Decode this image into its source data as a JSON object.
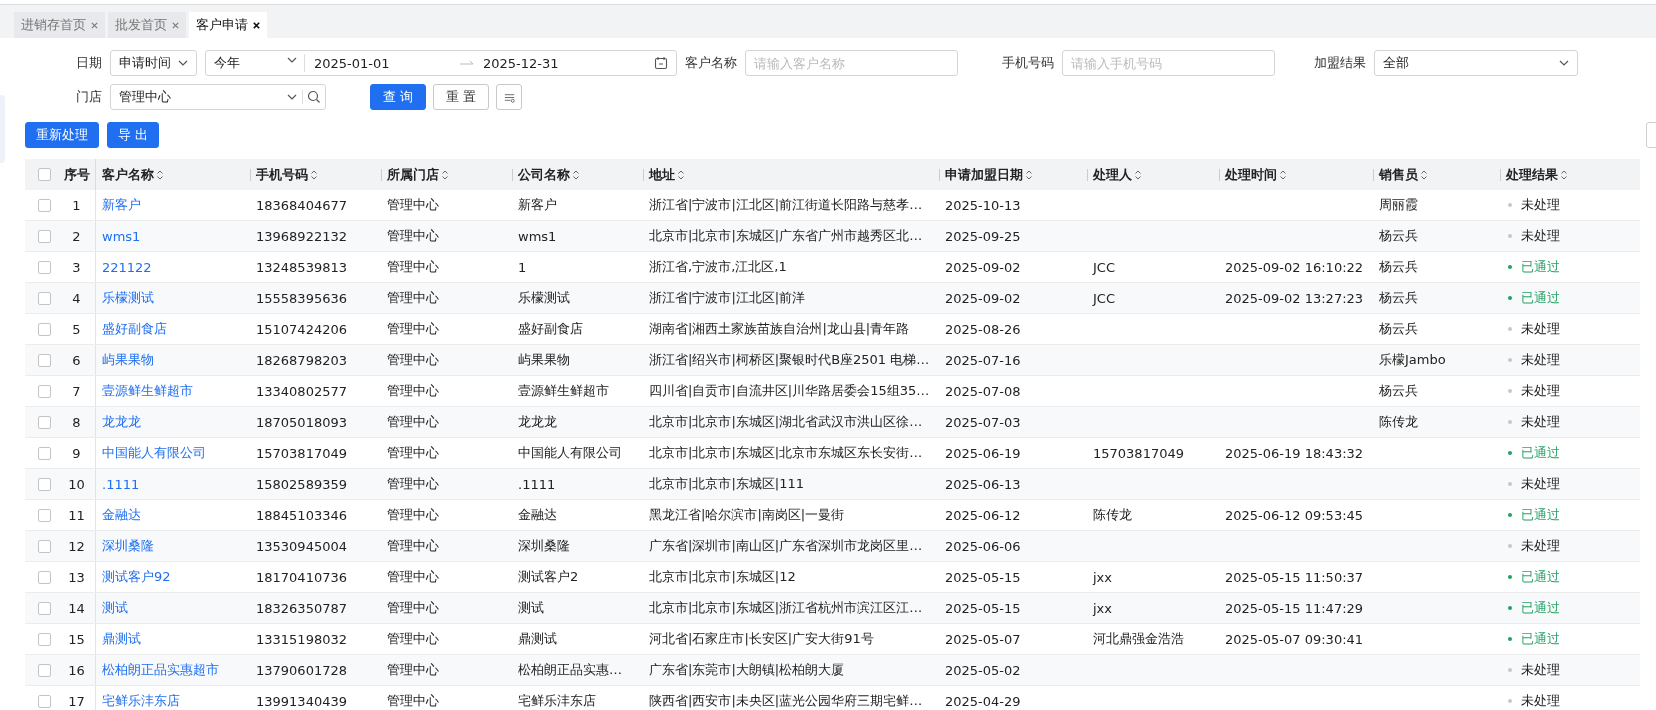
{
  "tabs": [
    {
      "label": "进销存首页",
      "selected": false
    },
    {
      "label": "批发首页",
      "selected": false
    },
    {
      "label": "客户申请",
      "selected": true
    }
  ],
  "filters": {
    "date_label": "日期",
    "date_type": "申请时间",
    "range_preset": "今年",
    "start_date": "2025-01-01",
    "end_date": "2025-12-31",
    "customer_label": "客户名称",
    "customer_placeholder": "请输入客户名称",
    "phone_label": "手机号码",
    "phone_placeholder": "请输入手机号码",
    "result_label": "加盟结果",
    "result_value": "全部",
    "store_label": "门店",
    "store_value": "管理中心",
    "query_button": "查 询",
    "reset_button": "重 置"
  },
  "actions": [
    "重新处理",
    "导 出"
  ],
  "table": {
    "select_all": {
      "checked": false
    },
    "columns": [
      "序号",
      "客户名称",
      "手机号码",
      "所属门店",
      "公司名称",
      "地址",
      "申请加盟日期",
      "处理人",
      "处理时间",
      "销售员",
      "处理结果"
    ],
    "rows": [
      {
        "checked": false,
        "index": "1",
        "name": "新客户",
        "phone": "18368404677",
        "store": "管理中心",
        "company": "新客户",
        "address": "浙江省|宁波市|江北区|前江街道长阳路与慈孝…",
        "date": "2025-10-13",
        "handler": "",
        "time": "",
        "sales": "周丽霞",
        "result": "未处理",
        "kind": "pending"
      },
      {
        "checked": false,
        "index": "2",
        "name": "wms1",
        "phone": "13968922132",
        "store": "管理中心",
        "company": "wms1",
        "address": "北京市|北京市|东城区|广东省广州市越秀区北…",
        "date": "2025-09-25",
        "handler": "",
        "time": "",
        "sales": "杨云兵",
        "result": "未处理",
        "kind": "pending"
      },
      {
        "checked": false,
        "index": "3",
        "name": "221122",
        "phone": "13248539813",
        "store": "管理中心",
        "company": "1",
        "address": "浙江省,宁波市,江北区,1",
        "date": "2025-09-02",
        "handler": "JCC",
        "time": "2025-09-02 16:10:22",
        "sales": "杨云兵",
        "result": "已通过",
        "kind": "approved"
      },
      {
        "checked": false,
        "index": "4",
        "name": "乐檬测试",
        "phone": "15558395636",
        "store": "管理中心",
        "company": "乐檬测试",
        "address": "浙江省|宁波市|江北区|前洋",
        "date": "2025-09-02",
        "handler": "JCC",
        "time": "2025-09-02 13:27:23",
        "sales": "杨云兵",
        "result": "已通过",
        "kind": "approved"
      },
      {
        "checked": false,
        "index": "5",
        "name": "盛好副食店",
        "phone": "15107424206",
        "store": "管理中心",
        "company": "盛好副食店",
        "address": "湖南省|湘西土家族苗族自治州|龙山县|青年路",
        "date": "2025-08-26",
        "handler": "",
        "time": "",
        "sales": "杨云兵",
        "result": "未处理",
        "kind": "pending"
      },
      {
        "checked": false,
        "index": "6",
        "name": "屿果果物",
        "phone": "18268798203",
        "store": "管理中心",
        "company": "屿果果物",
        "address": "浙江省|绍兴市|柯桥区|聚银时代B座2501 电梯…",
        "date": "2025-07-16",
        "handler": "",
        "time": "",
        "sales": "乐檬Jambo",
        "result": "未处理",
        "kind": "pending"
      },
      {
        "checked": false,
        "index": "7",
        "name": "壹源鲜生鲜超市",
        "phone": "13340802577",
        "store": "管理中心",
        "company": "壹源鲜生鲜超市",
        "address": "四川省|自贡市|自流井区|川华路居委会15组35…",
        "date": "2025-07-08",
        "handler": "",
        "time": "",
        "sales": "杨云兵",
        "result": "未处理",
        "kind": "pending"
      },
      {
        "checked": false,
        "index": "8",
        "name": "龙龙龙",
        "phone": "18705018093",
        "store": "管理中心",
        "company": "龙龙龙",
        "address": "北京市|北京市|东城区|湖北省武汉市洪山区徐…",
        "date": "2025-07-03",
        "handler": "",
        "time": "",
        "sales": "陈传龙",
        "result": "未处理",
        "kind": "pending"
      },
      {
        "checked": false,
        "index": "9",
        "name": "中国能人有限公司",
        "phone": "15703817049",
        "store": "管理中心",
        "company": "中国能人有限公司",
        "address": "北京市|北京市|东城区|北京市东城区东长安街…",
        "date": "2025-06-19",
        "handler": "15703817049",
        "time": "2025-06-19 18:43:32",
        "sales": "",
        "result": "已通过",
        "kind": "approved"
      },
      {
        "checked": false,
        "index": "10",
        "name": ".1111",
        "phone": "15802589359",
        "store": "管理中心",
        "company": ".1111",
        "address": "北京市|北京市|东城区|111",
        "date": "2025-06-13",
        "handler": "",
        "time": "",
        "sales": "",
        "result": "未处理",
        "kind": "pending"
      },
      {
        "checked": false,
        "index": "11",
        "name": "金融达",
        "phone": "18845103346",
        "store": "管理中心",
        "company": "金融达",
        "address": "黑龙江省|哈尔滨市|南岗区|一曼街",
        "date": "2025-06-12",
        "handler": "陈传龙",
        "time": "2025-06-12 09:53:45",
        "sales": "",
        "result": "已通过",
        "kind": "approved"
      },
      {
        "checked": false,
        "index": "12",
        "name": "深圳桑隆",
        "phone": "13530945004",
        "store": "管理中心",
        "company": "深圳桑隆",
        "address": "广东省|深圳市|南山区|广东省深圳市龙岗区里…",
        "date": "2025-06-06",
        "handler": "",
        "time": "",
        "sales": "",
        "result": "未处理",
        "kind": "pending"
      },
      {
        "checked": false,
        "index": "13",
        "name": "测试客户92",
        "phone": "18170410736",
        "store": "管理中心",
        "company": "测试客户2",
        "address": "北京市|北京市|东城区|12",
        "date": "2025-05-15",
        "handler": "jxx",
        "time": "2025-05-15 11:50:37",
        "sales": "",
        "result": "已通过",
        "kind": "approved"
      },
      {
        "checked": false,
        "index": "14",
        "name": "测试",
        "phone": "18326350787",
        "store": "管理中心",
        "company": "测试",
        "address": "北京市|北京市|东城区|浙江省杭州市滨江区江…",
        "date": "2025-05-15",
        "handler": "jxx",
        "time": "2025-05-15 11:47:29",
        "sales": "",
        "result": "已通过",
        "kind": "approved"
      },
      {
        "checked": false,
        "index": "15",
        "name": "鼎测试",
        "phone": "13315198032",
        "store": "管理中心",
        "company": "鼎测试",
        "address": "河北省|石家庄市|长安区|广安大街91号",
        "date": "2025-05-07",
        "handler": "河北鼎强金浩浩",
        "time": "2025-05-07 09:30:41",
        "sales": "",
        "result": "已通过",
        "kind": "approved"
      },
      {
        "checked": false,
        "index": "16",
        "name": "松柏朗正品实惠超市",
        "phone": "13790601728",
        "store": "管理中心",
        "company": "松柏朗正品实惠…",
        "address": "广东省|东莞市|大朗镇|松柏朗大厦",
        "date": "2025-05-02",
        "handler": "",
        "time": "",
        "sales": "",
        "result": "未处理",
        "kind": "pending"
      },
      {
        "checked": false,
        "index": "17",
        "name": "宅鲜乐沣东店",
        "phone": "13991340439",
        "store": "管理中心",
        "company": "宅鲜乐沣东店",
        "address": "陕西省|西安市|未央区|蓝光公园华府三期宅鲜…",
        "date": "2025-04-29",
        "handler": "",
        "time": "",
        "sales": "",
        "result": "未处理",
        "kind": "pending"
      }
    ]
  }
}
